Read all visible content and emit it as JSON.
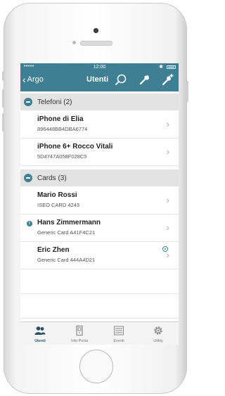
{
  "status_bar": {
    "signal": "•••••",
    "time": "12:00",
    "bluetooth": "✱"
  },
  "nav": {
    "back_label": "Argo",
    "back_chevron": "‹",
    "title": "Utenti",
    "icons": [
      "search-icon",
      "key-icon",
      "add-key-icon"
    ]
  },
  "sections": [
    {
      "label": "Telefoni (2)",
      "items": [
        {
          "title": "iPhone di Elia",
          "subtitle": "896448BB4DBA6774",
          "chevron": "›"
        },
        {
          "title": "iPhone 6+ Rocco Vitali",
          "subtitle": "5D4747A058F028C5",
          "chevron": "›"
        }
      ]
    },
    {
      "label": "Cards (3)",
      "items": [
        {
          "title": "Mario Rossi",
          "subtitle": "ISEO CARD 4243",
          "chevron": "›"
        },
        {
          "title": "Hans Zimmermann",
          "subtitle": "Generic Card A41F4C21",
          "chevron": "›",
          "info_badge": "i"
        },
        {
          "title": "Eric Zhen",
          "subtitle": "Generic Card 444A4D21",
          "chevron": "›",
          "status_icon": "radio-icon"
        }
      ]
    }
  ],
  "tabs": [
    {
      "label": "Utenti",
      "icon": "users-icon",
      "active": true
    },
    {
      "label": "Info Porta",
      "icon": "door-icon",
      "active": false
    },
    {
      "label": "Eventi",
      "icon": "list-icon",
      "active": false
    },
    {
      "label": "Utility",
      "icon": "gear-icon",
      "active": false
    }
  ],
  "colors": {
    "accent": "#3f7f93",
    "section_bg": "#e3e3e3",
    "tabbar_bg": "#f4f4f4"
  }
}
